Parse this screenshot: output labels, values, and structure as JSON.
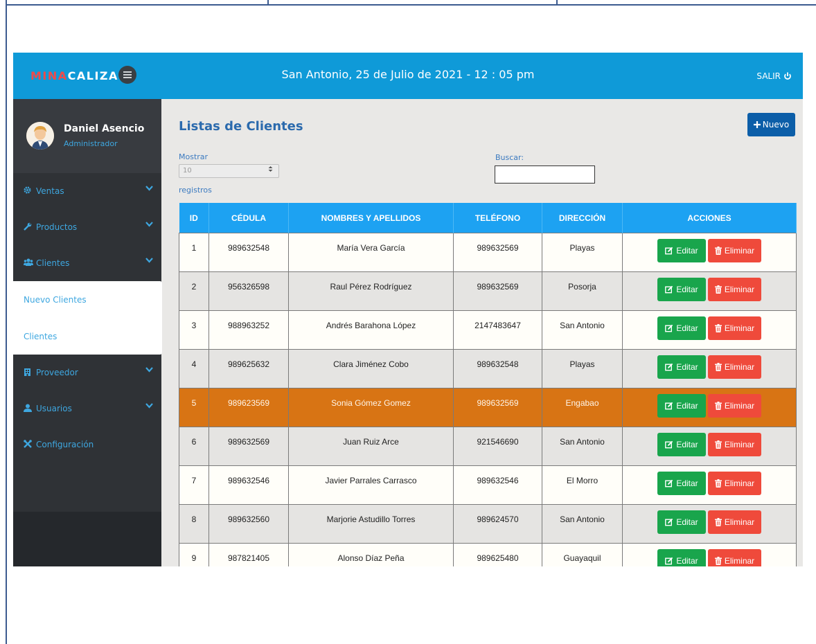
{
  "header": {
    "brand_part1": "MINA",
    "brand_part2": "CALIZA",
    "datetime": "San Antonio, 25 de Julio de 2021 - 12 : 05 pm",
    "logout_label": "SALIR"
  },
  "user": {
    "name": "Daniel Asencio",
    "role": "Administrador"
  },
  "sidebar": {
    "items": [
      {
        "label": "Ventas",
        "icon": "gear-icon"
      },
      {
        "label": "Productos",
        "icon": "wrench-icon"
      },
      {
        "label": "Clientes",
        "icon": "users-icon"
      },
      {
        "label": "Proveedor",
        "icon": "building-icon"
      },
      {
        "label": "Usuarios",
        "icon": "user-icon"
      },
      {
        "label": "Configuración",
        "icon": "tools-icon"
      }
    ],
    "submenu": [
      "Nuevo Clientes",
      "Clientes"
    ]
  },
  "main": {
    "title": "Listas de Clientes",
    "new_button": "Nuevo",
    "show_label": "Mostrar",
    "show_value": "10",
    "records_label": "registros",
    "search_label": "Buscar:",
    "search_value": ""
  },
  "table": {
    "columns": [
      "ID",
      "CÉDULA",
      "NOMBRES Y APELLIDOS",
      "TELÉFONO",
      "DIRECCIÓN",
      "ACCIONES"
    ],
    "edit_label": "Editar",
    "delete_label": "Eliminar",
    "rows": [
      {
        "id": "1",
        "cedula": "989632548",
        "nombre": "María Vera García",
        "telefono": "989632569",
        "direccion": "Playas"
      },
      {
        "id": "2",
        "cedula": "956326598",
        "nombre": "Raul Pérez Rodríguez",
        "telefono": "989632569",
        "direccion": "Posorja"
      },
      {
        "id": "3",
        "cedula": "988963252",
        "nombre": "Andrés Barahona López",
        "telefono": "2147483647",
        "direccion": "San Antonio"
      },
      {
        "id": "4",
        "cedula": "989625632",
        "nombre": "Clara Jiménez Cobo",
        "telefono": "989632548",
        "direccion": "Playas"
      },
      {
        "id": "5",
        "cedula": "989623569",
        "nombre": "Sonia Gómez Gomez",
        "telefono": "989632569",
        "direccion": "Engabao"
      },
      {
        "id": "6",
        "cedula": "989632569",
        "nombre": "Juan Ruiz Arce",
        "telefono": "921546690",
        "direccion": "San Antonio"
      },
      {
        "id": "7",
        "cedula": "989632546",
        "nombre": "Javier Parrales Carrasco",
        "telefono": "989632546",
        "direccion": "El Morro"
      },
      {
        "id": "8",
        "cedula": "989632560",
        "nombre": "Marjorie Astudillo Torres",
        "telefono": "989624570",
        "direccion": "San Antonio"
      },
      {
        "id": "9",
        "cedula": "987821405",
        "nombre": "Alonso Díaz Peña",
        "telefono": "989625480",
        "direccion": "Guayaquil"
      }
    ],
    "highlighted_row": 4
  },
  "colors": {
    "topbar": "#0f9ad8",
    "sidebar": "#2f3236",
    "accent": "#3ea7e0",
    "table_header": "#1da2f2",
    "highlight_row": "#d87414",
    "edit_button": "#19a54c",
    "delete_button": "#ef4a3b",
    "new_button": "#0c5ea8"
  }
}
